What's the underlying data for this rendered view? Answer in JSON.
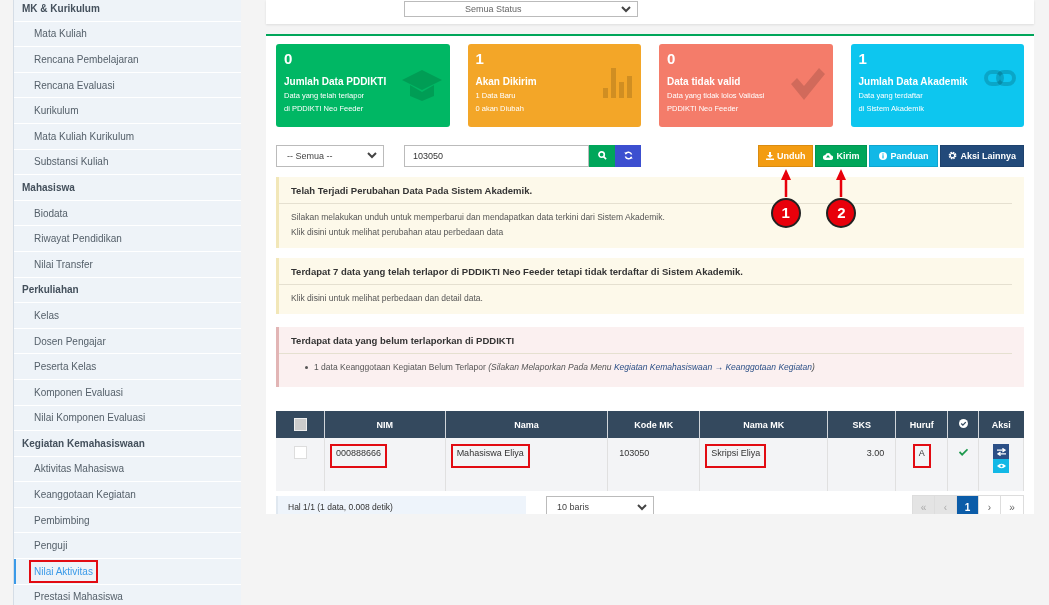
{
  "sidebar": {
    "groups": [
      {
        "title": "MK & Kurikulum",
        "items": [
          {
            "label": "Mata Kuliah",
            "selected": false,
            "highlighted": false
          },
          {
            "label": "Rencana Pembelajaran",
            "selected": false,
            "highlighted": false
          },
          {
            "label": "Rencana Evaluasi",
            "selected": false,
            "highlighted": false
          },
          {
            "label": "Kurikulum",
            "selected": false,
            "highlighted": false
          },
          {
            "label": "Mata Kuliah Kurikulum",
            "selected": false,
            "highlighted": false
          },
          {
            "label": "Substansi Kuliah",
            "selected": false,
            "highlighted": false
          }
        ]
      },
      {
        "title": "Mahasiswa",
        "items": [
          {
            "label": "Biodata",
            "selected": false,
            "highlighted": false
          },
          {
            "label": "Riwayat Pendidikan",
            "selected": false,
            "highlighted": false
          },
          {
            "label": "Nilai Transfer",
            "selected": false,
            "highlighted": false
          }
        ]
      },
      {
        "title": "Perkuliahan",
        "items": [
          {
            "label": "Kelas",
            "selected": false,
            "highlighted": false
          },
          {
            "label": "Dosen Pengajar",
            "selected": false,
            "highlighted": false
          },
          {
            "label": "Peserta Kelas",
            "selected": false,
            "highlighted": false
          },
          {
            "label": "Komponen Evaluasi",
            "selected": false,
            "highlighted": false
          },
          {
            "label": "Nilai Komponen Evaluasi",
            "selected": false,
            "highlighted": false
          }
        ]
      },
      {
        "title": "Kegiatan Kemahasiswaan",
        "items": [
          {
            "label": "Aktivitas Mahasiswa",
            "selected": false,
            "highlighted": false
          },
          {
            "label": "Keanggotaan Kegiatan",
            "selected": false,
            "highlighted": false
          },
          {
            "label": "Pembimbing",
            "selected": false,
            "highlighted": false
          },
          {
            "label": "Penguji",
            "selected": false,
            "highlighted": false
          },
          {
            "label": "Nilai Aktivitas",
            "selected": true,
            "highlighted": true
          },
          {
            "label": "Prestasi Mahasiswa",
            "selected": false,
            "highlighted": false
          }
        ]
      }
    ]
  },
  "status_filter": {
    "value": "Semua Status"
  },
  "stat_cards": [
    {
      "kind": "graduation",
      "count": "0",
      "title": "Jumlah Data PDDIKTI",
      "lines": [
        "Data yang telah terlapor",
        "di PDDIKTI Neo Feeder"
      ],
      "color": "#00b764"
    },
    {
      "kind": "bars",
      "count": "1",
      "title": "Akan Dikirim",
      "lines": [
        "1 Data Baru",
        "0 akan Diubah"
      ],
      "color": "#f3a628"
    },
    {
      "kind": "check",
      "count": "0",
      "title": "Data tidak valid",
      "lines": [
        "Data yang tidak lolos Validasi",
        "PDDIKTI Neo Feeder"
      ],
      "color": "#f47c6a"
    },
    {
      "kind": "link",
      "count": "1",
      "title": "Jumlah Data Akademik",
      "lines": [
        "Data yang terdaftar",
        "di Sistem Akademik"
      ],
      "color": "#0dc6ef"
    }
  ],
  "filter": {
    "select": "-- Semua --",
    "search_value": "103050"
  },
  "actions": [
    {
      "kind": "download",
      "label": "Unduh",
      "callout": "1"
    },
    {
      "kind": "upload",
      "label": "Kirim",
      "callout": "2"
    },
    {
      "kind": "info",
      "label": "Panduan"
    },
    {
      "kind": "gear",
      "label": "Aksi Lainnya"
    }
  ],
  "alerts": [
    {
      "kind": "warning",
      "title": "Telah Terjadi Perubahan Data Pada Sistem Akademik.",
      "lines": [
        "Silakan melakukan unduh untuk memperbarui dan mendapatkan data terkini dari Sistem Akademik.",
        "Klik disini untuk melihat perubahan atau perbedaan data"
      ]
    },
    {
      "kind": "warning",
      "title": "Terdapat 7 data yang telah terlapor di PDDIKTI Neo Feeder tetapi tidak terdaftar di Sistem Akademik.",
      "lines": [
        "Klik disini untuk melihat perbedaan dan detail data."
      ]
    },
    {
      "kind": "danger",
      "title": "Terdapat data yang belum terlaporkan di PDDIKTI",
      "items": [
        {
          "text": "1 data Keanggotaan Kegiatan Belum Terlapor",
          "note": "(Silakan Melaporkan Pada Menu",
          "link": "Kegiatan Kemahasiswaan → Keanggotaan Kegiatan",
          "note_end": ")"
        }
      ]
    }
  ],
  "table": {
    "select_all_checked": false,
    "columns": [
      "NIM",
      "Nama",
      "Kode MK",
      "Nama MK",
      "SKS",
      "Huruf",
      "Aksi"
    ],
    "rows": [
      {
        "checked": false,
        "valid": true,
        "cells": [
          {
            "text": "000888666",
            "highlighted": true
          },
          {
            "text": "Mahasiswa Eliya",
            "highlighted": true
          },
          {
            "text": "103050",
            "highlighted": false
          },
          {
            "text": "Skripsi Eliya",
            "highlighted": true
          },
          {
            "text": "3.00",
            "highlighted": false
          },
          {
            "text": "A",
            "highlighted": true
          }
        ]
      }
    ]
  },
  "footer": {
    "info": "Hal 1/1 (1 data, 0.008 detik)",
    "page_size": "10 baris",
    "pager": [
      {
        "label": "«",
        "selected": false,
        "disabled": true
      },
      {
        "label": "‹",
        "selected": false,
        "disabled": true
      },
      {
        "label": "1",
        "selected": true,
        "disabled": false
      },
      {
        "label": "›",
        "selected": false,
        "disabled": false
      },
      {
        "label": "»",
        "selected": false,
        "disabled": false
      }
    ]
  }
}
